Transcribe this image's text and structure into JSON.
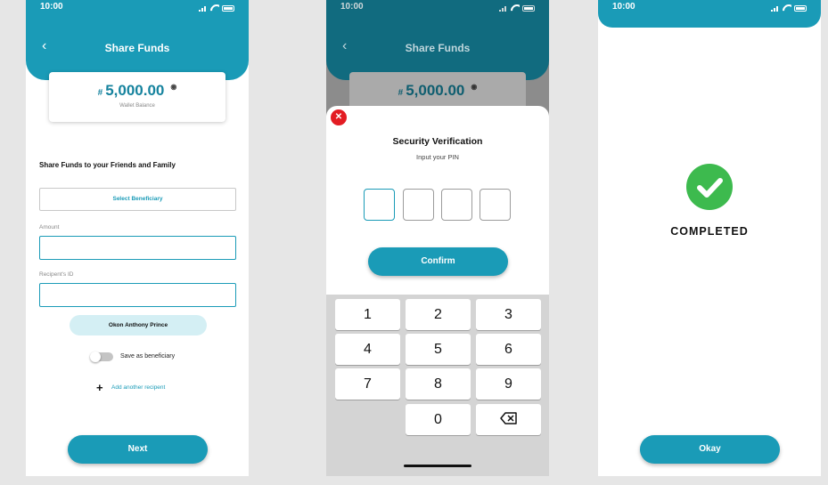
{
  "status": {
    "time": "10:00"
  },
  "share": {
    "header_title": "Share Funds",
    "currency_symbol": "#",
    "balance_amount": "5,000.00",
    "balance_label": "Wallet Balance",
    "section_title": "Share Funds to your Friends and Family",
    "select_beneficiary": "Select Beneficiary",
    "amount_label": "Amount",
    "amount_value": "",
    "recipient_label": "Recipent's ID",
    "recipient_value": "",
    "recipient_name": "Okon Anthony Prince",
    "save_toggle_label": "Save as beneficiary",
    "save_toggle_on": false,
    "add_recipient": "Add another recipent",
    "next_button": "Next"
  },
  "verify": {
    "title": "Security Verification",
    "subtitle": "Input your PIN",
    "pin_length": 4,
    "confirm_button": "Confirm",
    "keys": [
      "1",
      "2",
      "3",
      "4",
      "5",
      "6",
      "7",
      "8",
      "9",
      "0"
    ],
    "backspace_icon": "backspace-icon",
    "close_icon": "close-icon"
  },
  "done": {
    "status_text": "COMPLETED",
    "okay_button": "Okay",
    "check_icon": "check-circle-icon"
  },
  "colors": {
    "primary": "#1a9bb7",
    "success": "#3dba4e",
    "danger": "#e31c23"
  }
}
